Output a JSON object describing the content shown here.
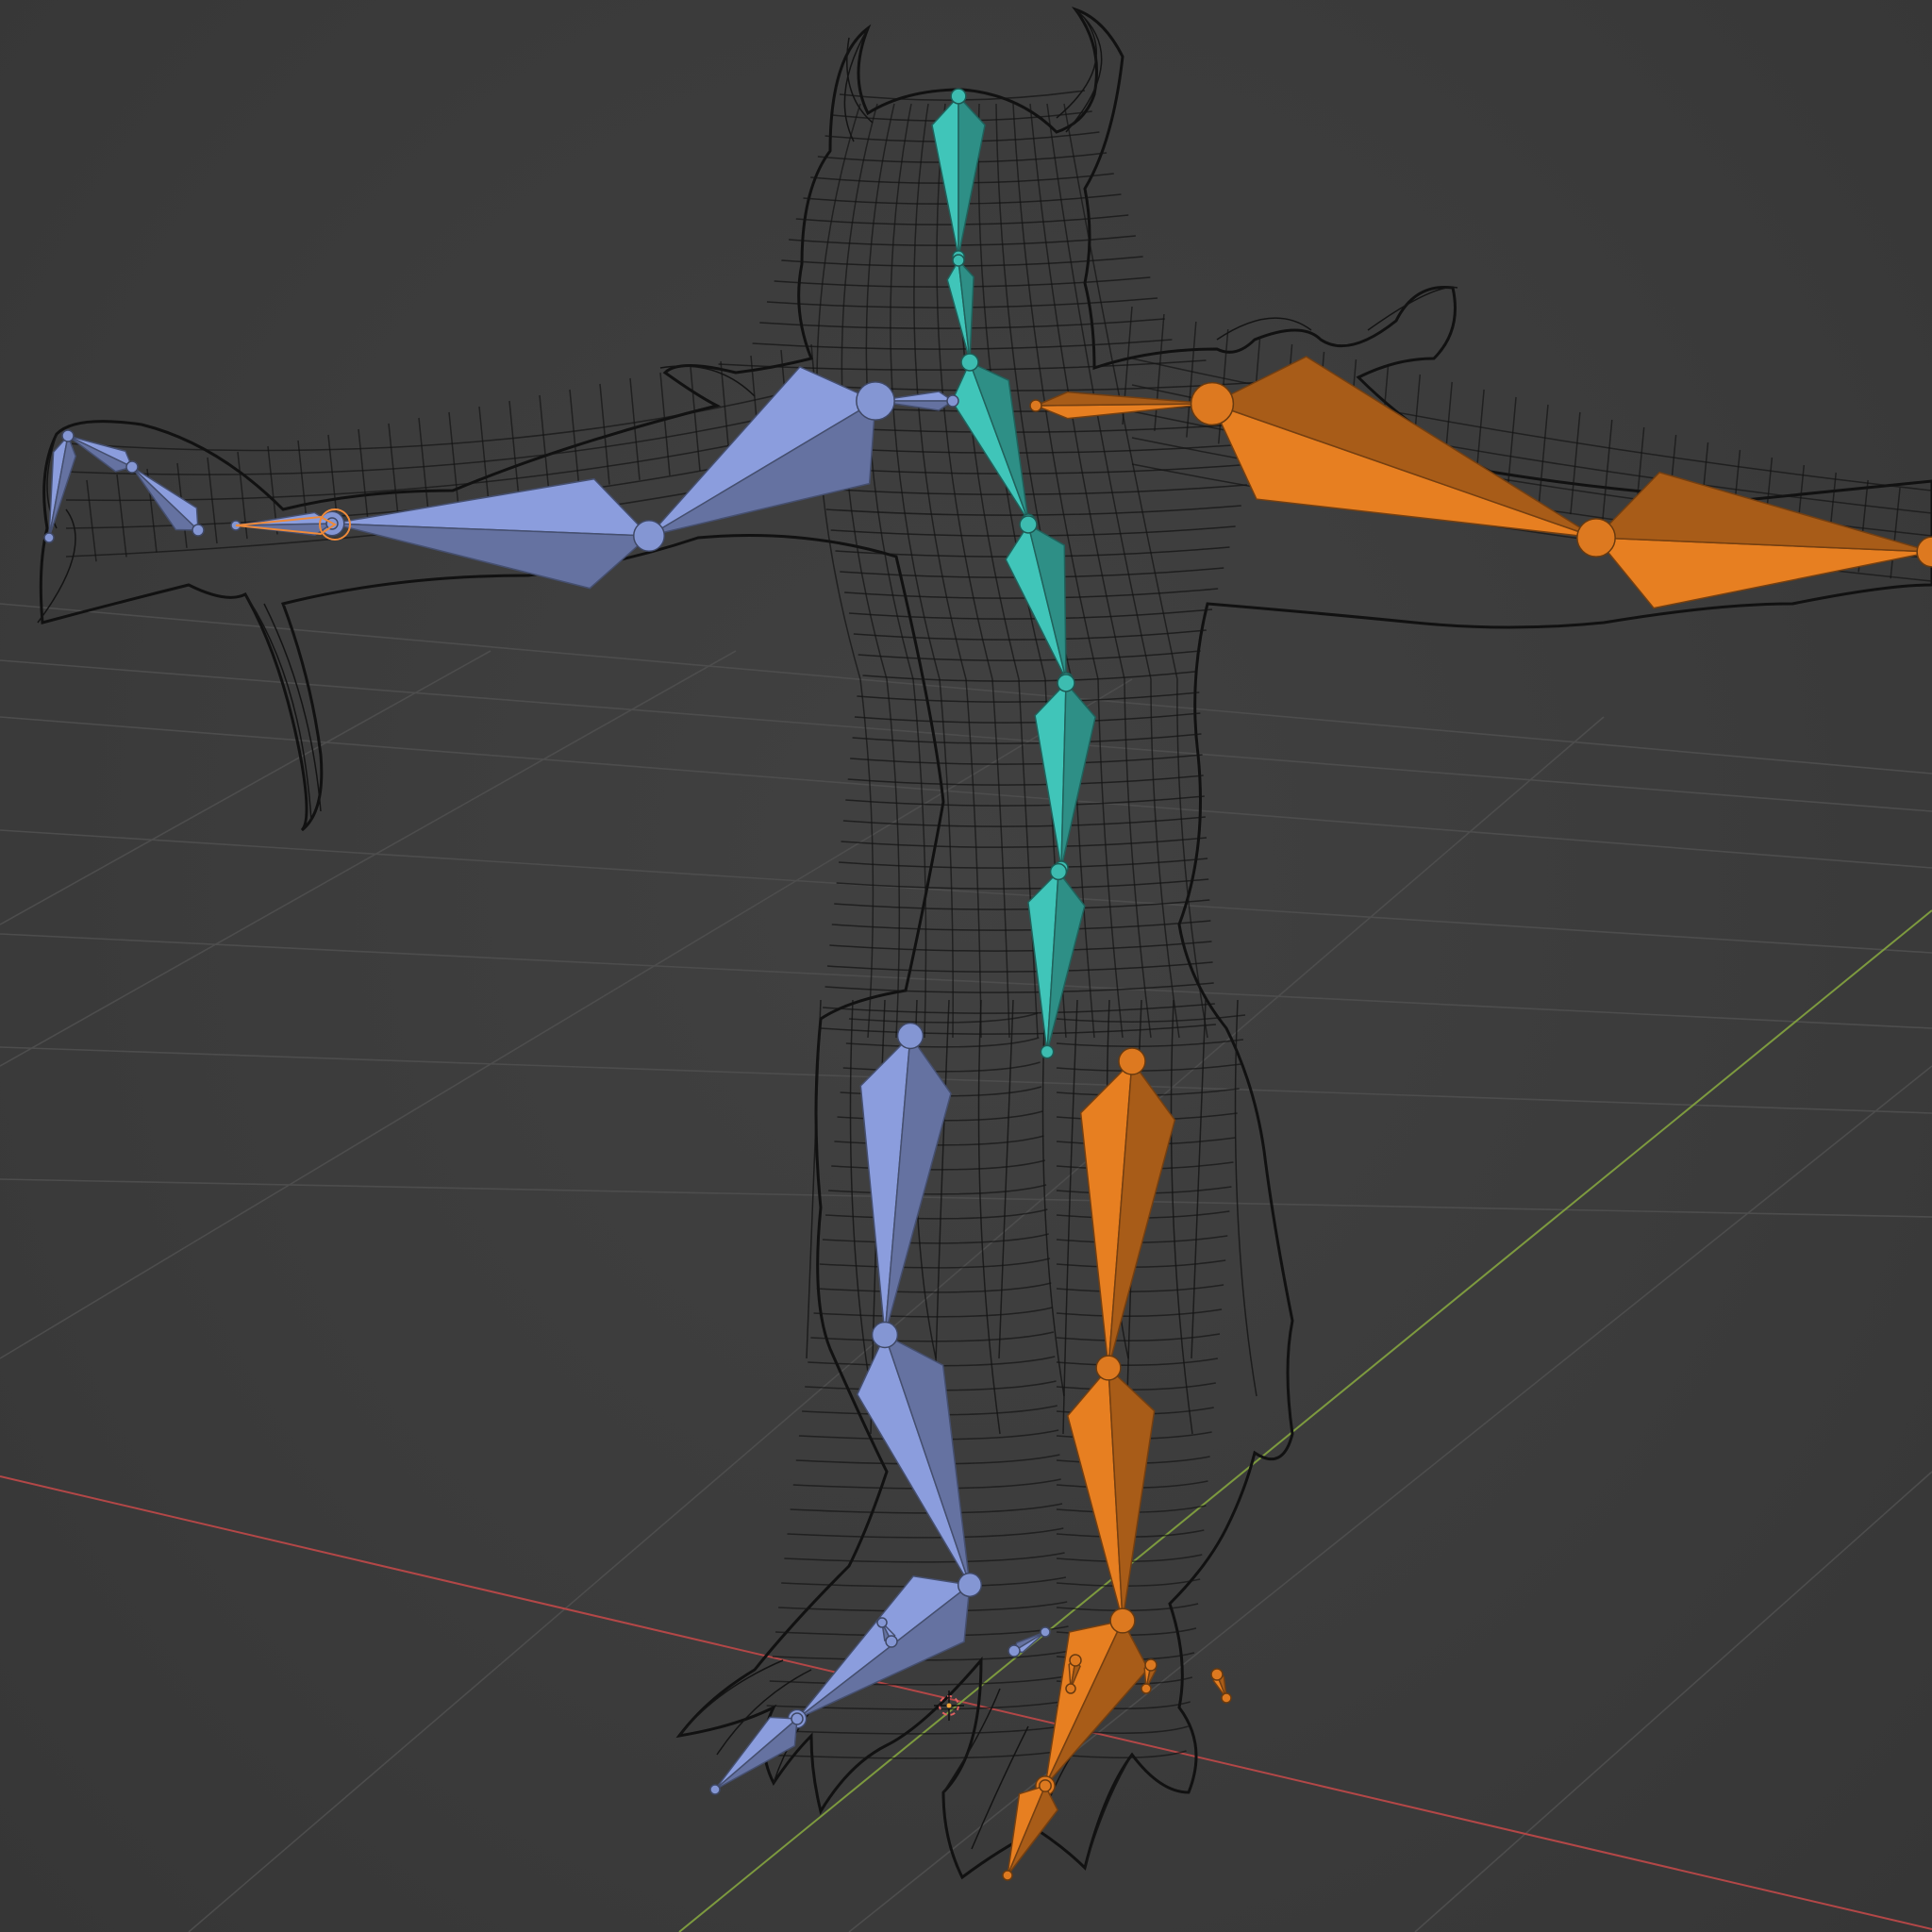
{
  "viewport": {
    "background": "#3d3d3d",
    "grid_color": "#4d4d4d",
    "x_axis_color": "#b34747",
    "y_axis_color": "#7d9a3f",
    "wireframe_color": "#141414"
  },
  "armature": {
    "spine_color": "#3ab3a8",
    "left_color": "#7e8fc9",
    "right_color": "#d2731e",
    "selected_outline": "#ee8a3a"
  },
  "icons": {
    "origin": "3d-cursor-icon"
  }
}
